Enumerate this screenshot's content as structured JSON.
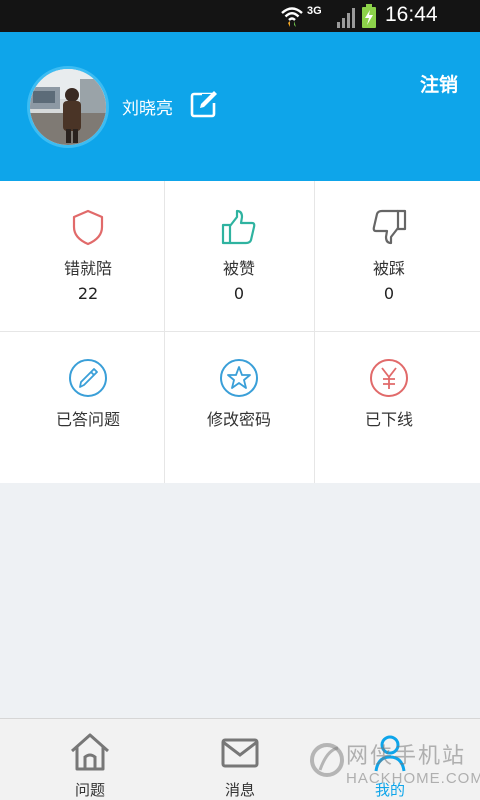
{
  "status_bar": {
    "network": "3G",
    "time": "16:44",
    "icons": [
      "wifi-icon",
      "signal-icon",
      "battery-charging-icon"
    ]
  },
  "header": {
    "username": "刘晓亮",
    "logout_label": "注销",
    "bg_color": "#0ea5ea"
  },
  "grid": {
    "items": [
      {
        "label": "错就陪",
        "count": "22",
        "icon": "shield-icon",
        "color": "#e16a6a"
      },
      {
        "label": "被赞",
        "count": "0",
        "icon": "thumbs-up-icon",
        "color": "#2fb3a0"
      },
      {
        "label": "被踩",
        "count": "0",
        "icon": "thumbs-down-icon",
        "color": "#666666"
      },
      {
        "label": "已答问题",
        "icon": "pencil-circle-icon",
        "color": "#3a9fd8"
      },
      {
        "label": "修改密码",
        "icon": "star-circle-icon",
        "color": "#3a9fd8"
      },
      {
        "label": "已下线",
        "icon": "yen-circle-icon",
        "color": "#e16a6a"
      }
    ]
  },
  "bottom_nav": {
    "items": [
      {
        "label": "问题",
        "icon": "home-icon"
      },
      {
        "label": "消息",
        "icon": "mail-icon"
      },
      {
        "label": "我的",
        "icon": "user-icon",
        "active": true
      }
    ]
  },
  "watermark": {
    "text": "网侠手机站",
    "sub": "HACKHOME.COM"
  }
}
